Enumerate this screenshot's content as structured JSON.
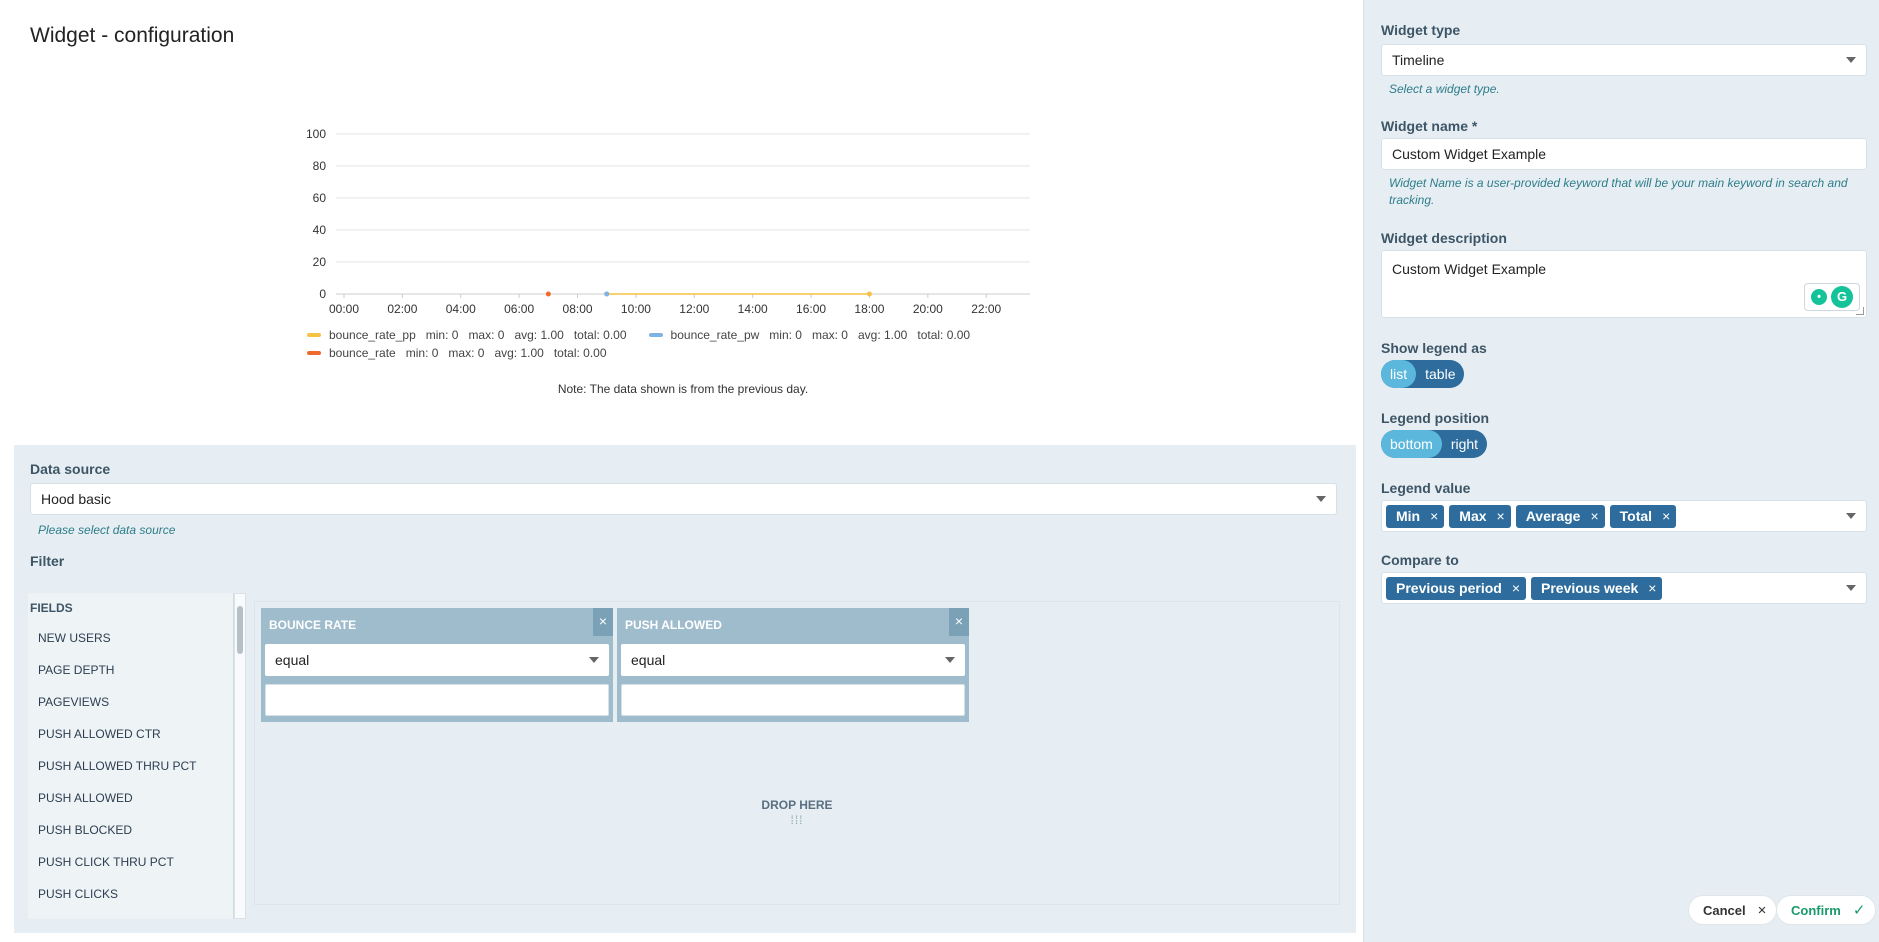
{
  "page": {
    "title": "Widget - configuration"
  },
  "chart_data": {
    "type": "line",
    "x_ticks": [
      "00:00",
      "02:00",
      "04:00",
      "06:00",
      "08:00",
      "10:00",
      "12:00",
      "14:00",
      "16:00",
      "18:00",
      "20:00",
      "22:00"
    ],
    "y_ticks": [
      0,
      20,
      40,
      60,
      80,
      100
    ],
    "ylim": [
      0,
      100
    ],
    "xlim_hours": [
      0,
      23.5
    ],
    "grid": true,
    "legend_placement": "bottom",
    "series": [
      {
        "name": "bounce_rate_pp",
        "color": "#f5c242",
        "points": [
          [
            9,
            0
          ],
          [
            18,
            0
          ]
        ],
        "stats": {
          "min": "min: 0",
          "max": "max: 0",
          "avg": "avg: 1.00",
          "total": "total: 0.00"
        }
      },
      {
        "name": "bounce_rate_pw",
        "color": "#7fb2e5",
        "points": [
          [
            9,
            0
          ]
        ],
        "stats": {
          "min": "min: 0",
          "max": "max: 0",
          "avg": "avg: 1.00",
          "total": "total: 0.00"
        }
      },
      {
        "name": "bounce_rate",
        "color": "#f06a2b",
        "points": [
          [
            7,
            0
          ]
        ],
        "stats": {
          "min": "min: 0",
          "max": "max: 0",
          "avg": "avg: 1.00",
          "total": "total: 0.00"
        }
      }
    ],
    "note": "Note: The data shown is from the previous day."
  },
  "data_source": {
    "label": "Data source",
    "value": "Hood basic",
    "hint": "Please select data source"
  },
  "filter": {
    "label": "Filter",
    "fields_header": "FIELDS",
    "fields": [
      "NEW USERS",
      "PAGE DEPTH",
      "PAGEVIEWS",
      "PUSH ALLOWED CTR",
      "PUSH ALLOWED THRU PCT",
      "PUSH ALLOWED",
      "PUSH BLOCKED",
      "PUSH CLICK THRU PCT",
      "PUSH CLICKS"
    ],
    "cards": [
      {
        "title": "BOUNCE RATE",
        "operator": "equal",
        "close": "×"
      },
      {
        "title": "PUSH ALLOWED",
        "operator": "equal",
        "close": "×"
      }
    ],
    "drop_text": "DROP HERE",
    "drop_dots": "⁞⁞⁞"
  },
  "sidebar": {
    "widget_type": {
      "label": "Widget type",
      "value": "Timeline",
      "hint": "Select a widget type."
    },
    "widget_name": {
      "label": "Widget name *",
      "value": "Custom Widget Example",
      "hint": "Widget Name is a user-provided keyword that will be your main keyword in search and tracking."
    },
    "widget_description": {
      "label": "Widget description",
      "value": "Custom Widget Example"
    },
    "show_legend_as": {
      "label": "Show legend as",
      "options": [
        "list",
        "table"
      ],
      "selected": "list"
    },
    "legend_position": {
      "label": "Legend position",
      "options": [
        "bottom",
        "right"
      ],
      "selected": "bottom"
    },
    "legend_value": {
      "label": "Legend value",
      "tags": [
        "Min",
        "Max",
        "Average",
        "Total"
      ]
    },
    "compare_to": {
      "label": "Compare to",
      "tags": [
        "Previous period",
        "Previous week"
      ]
    },
    "buttons": {
      "cancel": "Cancel",
      "confirm": "Confirm"
    }
  },
  "icons": {
    "close": "×",
    "check": "✓",
    "grammarly_bulb": "lightbulb-icon",
    "grammarly_g": "G"
  }
}
